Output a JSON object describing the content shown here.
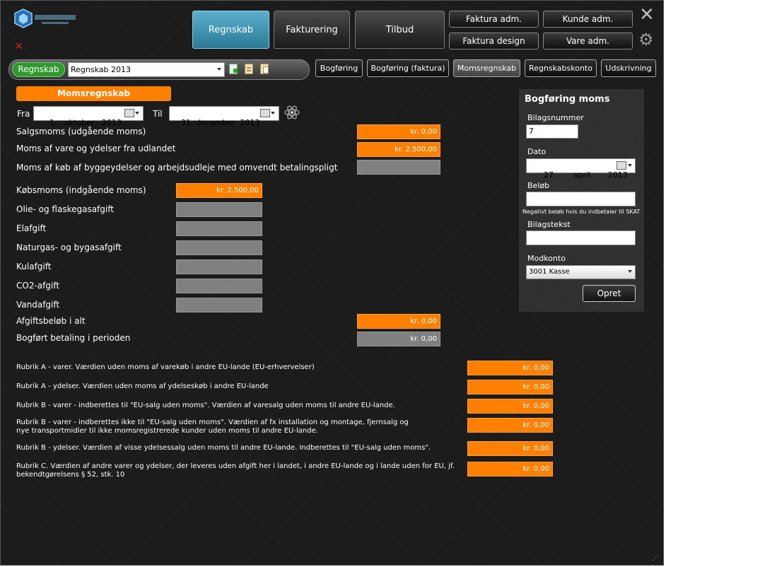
{
  "nav": {
    "regnskab": "Regnskab",
    "fakturering": "Fakturering",
    "tilbud": "Tilbud",
    "faktura_adm": "Faktura adm.",
    "kunde_adm": "Kunde adm.",
    "faktura_design": "Faktura design",
    "vare_adm": "Vare adm."
  },
  "toolbar": {
    "badge": "Regnskab",
    "selected_regnskab": "Regnskab 2013"
  },
  "tabs": [
    "Bogføring",
    "Bogføring (faktura)",
    "Momsregnskab",
    "Regnskabskonto",
    "Udskrivning"
  ],
  "section_title": "Momsregnskab",
  "period": {
    "fra_label": "Fra",
    "fra_value": "1.   oktober   2013",
    "til_label": "Til",
    "til_value": "31. december  2013"
  },
  "rows": {
    "salgsmoms_label": "Salgsmoms (udgående moms)",
    "salgsmoms_value": "kr. 0,00",
    "udland_label": "Moms af vare og ydelser fra udlandet",
    "udland_value": "kr. 2.500,00",
    "byggeydelser_label": "Moms af køb af byggeydelser og arbejdsudleje med omvendt betalingspligt",
    "kobsmoms_label": "Købsmoms (indgående moms)",
    "kobsmoms_value": "kr. 2.500,00",
    "olie_label": "Olie- og flaskegasafgift",
    "elafgift_label": "Elafgift",
    "naturgas_label": "Naturgas- og bygasafgift",
    "kulafgift_label": "Kulafgift",
    "co2_label": "CO2-afgift",
    "vand_label": "Vandafgift",
    "afgift_alt_label": "Afgiftsbeløb i alt",
    "afgift_alt_value": "kr. 0,00",
    "bogfort_label": "Bogført betaling i perioden",
    "bogfort_value": "kr. 0,00"
  },
  "rubrik": [
    {
      "label": "Rubrik A - varer. Værdien uden moms af varekøb i andre EU-lande (EU-erhvervelser)",
      "value": "kr. 0,00"
    },
    {
      "label": "Rubrik A - ydelser. Værdien uden moms af ydelseskøb i andre EU-lande",
      "value": "kr. 0,00"
    },
    {
      "label": "Rubrik B - varer - indberettes til \"EU-salg uden moms\". Værdien af varesalg uden moms til andre EU-lande.",
      "value": "kr. 0,00"
    },
    {
      "label": "Rubrik B - varer - indberettes ikke til \"EU-salg uden moms\". Værdien af fx installation og montage, fjernsalg og nye transportmidler til ikke momsregistrerede kunder uden moms til andre EU-lande.",
      "value": "kr. 0,00"
    },
    {
      "label": "Rubrik B - ydelser. Værdien af visse ydelsessalg uden moms til andre EU-lande. Indberettes til \"EU-salg uden moms\".",
      "value": "kr. 0,00"
    },
    {
      "label": "Rubrik C. Værdien af andre varer og ydelser, der leveres uden afgift her i landet, i andre EU-lande og i lande uden for EU, jf. bekendtgørelsens § 52, stk. 10",
      "value": "kr. 0,00"
    }
  ],
  "panel": {
    "title": "Bogføring moms",
    "bilagsnummer_label": "Bilagsnummer",
    "bilagsnummer_value": "7",
    "dato_label": "Dato",
    "dato_value": "27.       april       2013",
    "belob_label": "Beløb",
    "belob_value": "",
    "belob_hint": "Negativt beløb hvis du indbetaler til SKAT",
    "bilagstekst_label": "Bilagstekst",
    "bilagstekst_value": "",
    "modkonto_label": "Modkonto",
    "modkonto_value": "3001 Kasse",
    "opret_label": "Opret"
  },
  "colors": {
    "accent_orange": "#ff8000",
    "active_blue": "#3d93b0",
    "badge_green": "#2e9a2e"
  }
}
